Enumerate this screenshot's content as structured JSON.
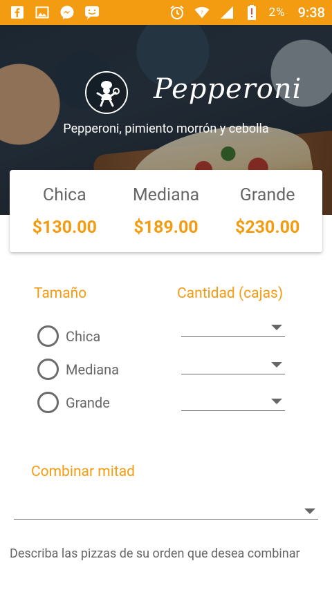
{
  "status_bar": {
    "battery_pct": "2%",
    "time": "9:38",
    "icons": [
      "facebook-icon",
      "gallery-icon",
      "messenger-icon",
      "chat-icon",
      "alarm-icon",
      "wifi-icon",
      "signal-icon",
      "battery-icon"
    ]
  },
  "hero": {
    "title": "Pepperoni",
    "subtitle": "Pepperoni, pimiento morrón y cebolla"
  },
  "prices": [
    {
      "size": "Chica",
      "price": "$130.00"
    },
    {
      "size": "Mediana",
      "price": "$189.00"
    },
    {
      "size": "Grande",
      "price": "$230.00"
    }
  ],
  "form": {
    "size_label": "Tamaño",
    "quantity_label": "Cantidad (cajas)",
    "options": [
      "Chica",
      "Mediana",
      "Grande"
    ],
    "combine_label": "Combinar mitad",
    "describe_text": "Describa las pizzas de su orden que desea combinar"
  },
  "colors": {
    "accent": "#f39c12",
    "status_bar": "#f39c12"
  }
}
